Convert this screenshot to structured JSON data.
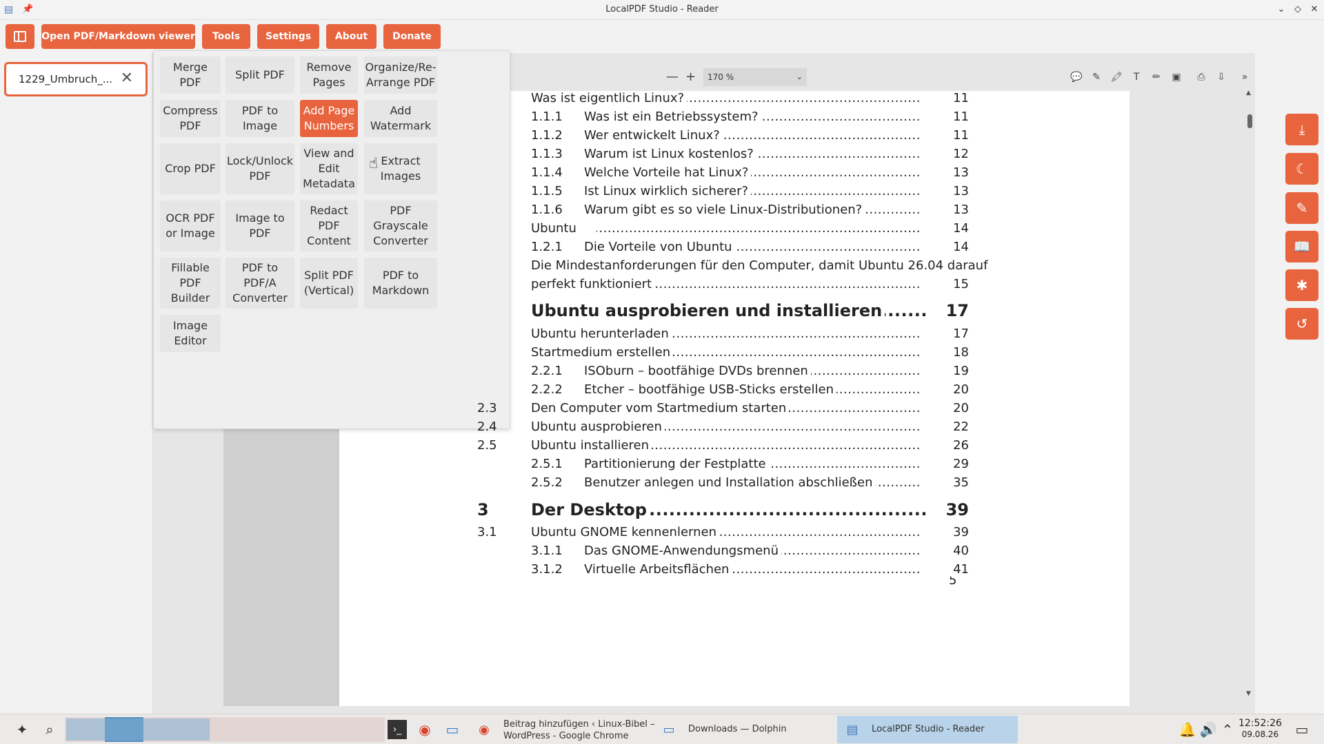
{
  "window": {
    "title": "LocalPDF Studio - Reader"
  },
  "toolbar": {
    "open_label": "Open PDF/Markdown viewer",
    "tools_label": "Tools",
    "settings_label": "Settings",
    "about_label": "About",
    "donate_label": "Donate"
  },
  "file_tab": {
    "name": "1229_Umbruch_..."
  },
  "viewer": {
    "zoom": "170 %"
  },
  "tools": [
    [
      "Merge",
      "PDF"
    ],
    [
      "Split PDF"
    ],
    [
      "Remove",
      "Pages"
    ],
    [
      "Organize/Re-",
      "Arrange PDF"
    ],
    [
      "Compress",
      "PDF"
    ],
    [
      "PDF to",
      "Image"
    ],
    [
      "Add Page",
      "Numbers"
    ],
    [
      "Add",
      "Watermark"
    ],
    [
      "Crop PDF"
    ],
    [
      "Lock/Unlock",
      "PDF"
    ],
    [
      "View and",
      "Edit",
      "Metadata"
    ],
    [
      "Extract",
      "Images"
    ],
    [
      "OCR PDF",
      "or Image"
    ],
    [
      "Image to",
      "PDF"
    ],
    [
      "Redact",
      "PDF",
      "Content"
    ],
    [
      "PDF",
      "Grayscale",
      "Converter"
    ],
    [
      "Fillable",
      "PDF",
      "Builder"
    ],
    [
      "PDF to",
      "PDF/A",
      "Converter"
    ],
    [
      "Split PDF",
      "(Vertical)"
    ],
    [
      "PDF to",
      "Markdown"
    ],
    [
      "Image",
      "Editor"
    ]
  ],
  "active_tool": "Add Page Numbers",
  "toc": [
    {
      "num": "",
      "text": "Was ist eigentlich Linux?",
      "page": "11"
    },
    {
      "num": "1.1.1",
      "text": "Was ist ein Betriebssystem?",
      "page": "11"
    },
    {
      "num": "1.1.2",
      "text": "Wer entwickelt Linux?",
      "page": "11"
    },
    {
      "num": "1.1.3",
      "text": "Warum ist Linux kostenlos?",
      "page": "12"
    },
    {
      "num": "1.1.4",
      "text": "Welche Vorteile hat Linux?",
      "page": "13"
    },
    {
      "num": "1.1.5",
      "text": "Ist Linux wirklich sicherer?",
      "page": "13"
    },
    {
      "num": "1.1.6",
      "text": "Warum gibt es so viele Linux-Distributionen?",
      "page": "13"
    },
    {
      "num": "",
      "text": "Ubuntu",
      "page": "14"
    },
    {
      "num": "1.2.1",
      "text": "Die Vorteile von Ubuntu",
      "page": "14"
    },
    {
      "num": "",
      "text": "Die Mindestanforderungen für den Computer, damit Ubuntu 26.04 darauf",
      "page": ""
    },
    {
      "num": "",
      "text": "perfekt funktioniert",
      "page": "15"
    },
    {
      "num": "",
      "text": "Ubuntu ausprobieren und installieren",
      "page": "17",
      "big": true
    },
    {
      "num": "",
      "text": "Ubuntu herunterladen",
      "page": "17"
    },
    {
      "num": "",
      "text": "Startmedium erstellen",
      "page": "18"
    },
    {
      "num": "2.2.1",
      "text": "ISOburn – bootfähige DVDs brennen",
      "page": "19"
    },
    {
      "num": "2.2.2",
      "text": "Etcher – bootfähige USB-Sticks erstellen",
      "page": "20"
    },
    {
      "num": "2.3",
      "text": "Den Computer vom Startmedium starten",
      "page": "20"
    },
    {
      "num": "2.4",
      "text": "Ubuntu ausprobieren",
      "page": "22"
    },
    {
      "num": "2.5",
      "text": "Ubuntu installieren",
      "page": "26"
    },
    {
      "num": "2.5.1",
      "text": "Partitionierung der Festplatte",
      "page": "29"
    },
    {
      "num": "2.5.2",
      "text": "Benutzer anlegen und Installation abschließen",
      "page": "35"
    },
    {
      "num": "3",
      "text": "Der Desktop",
      "page": "39",
      "big": true
    },
    {
      "num": "3.1",
      "text": "Ubuntu GNOME kennenlernen",
      "page": "39"
    },
    {
      "num": "3.1.1",
      "text": "Das GNOME-Anwendungsmenü",
      "page": "40"
    },
    {
      "num": "3.1.2",
      "text": "Virtuelle Arbeitsflächen",
      "page": "41"
    }
  ],
  "page_number": "5",
  "taskbar": {
    "tasks": [
      {
        "line1": "Beitrag hinzufügen ‹ Linux-Bibel –",
        "line2": "WordPress - Google Chrome"
      },
      {
        "line1": "Downloads — Dolphin",
        "line2": ""
      },
      {
        "line1": "LocalPDF Studio - Reader",
        "line2": ""
      }
    ],
    "time": "12:52:26",
    "date": "09.08.26"
  },
  "icons": {
    "app": "pdf-app-icon",
    "pin": "pin-icon",
    "minimize": "chevron-down-icon",
    "maximize": "diamond-icon",
    "close": "close-icon"
  },
  "colors": {
    "accent": "#e8643e"
  }
}
